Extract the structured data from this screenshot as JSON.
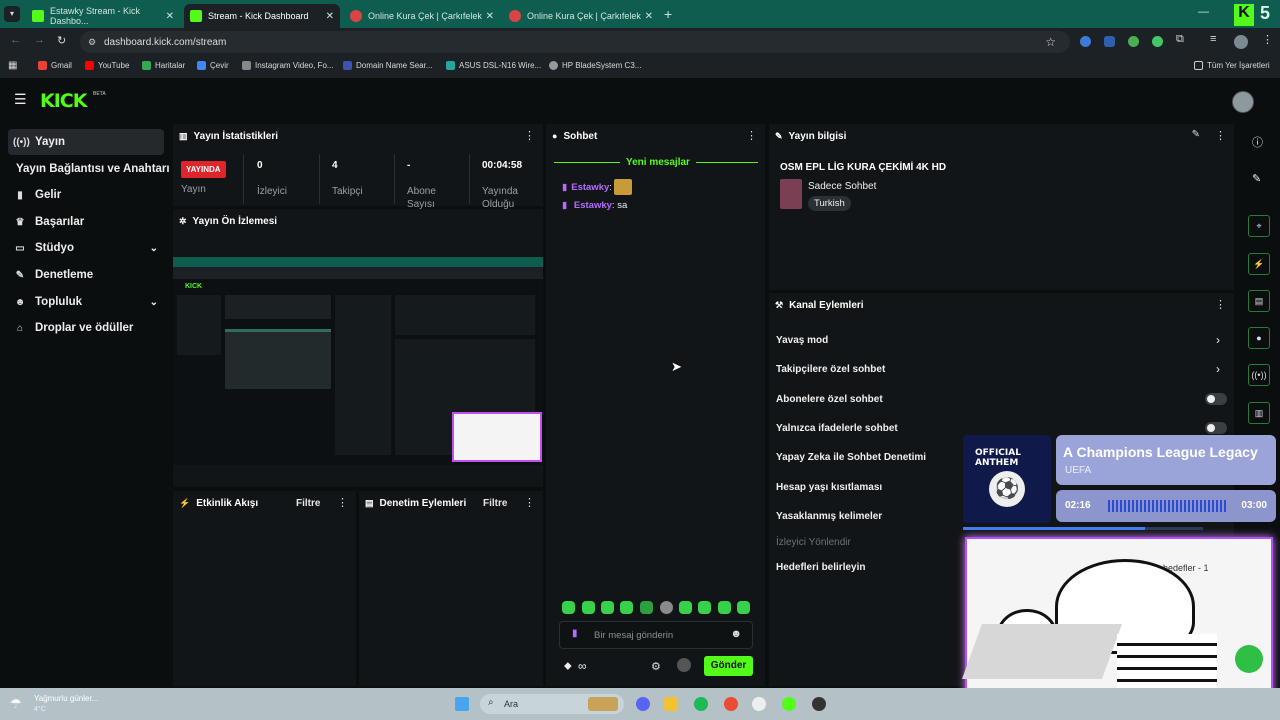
{
  "browser": {
    "tabs": [
      {
        "title": "Estawky Stream - Kick Dashbo..."
      },
      {
        "title": "Stream - Kick Dashboard"
      },
      {
        "title": "Online Kura Çek | Çarkıfelek"
      },
      {
        "title": "Online Kura Çek | Çarkıfelek"
      }
    ],
    "url": "dashboard.kick.com/stream",
    "bookmarks": [
      "Gmail",
      "YouTube",
      "Haritalar",
      "Çevir",
      "Instagram Video, Fo...",
      "Domain Name Sear...",
      "ASUS DSL-N16 Wire...",
      "HP BladeSystem C3..."
    ],
    "all_bookmarks": "Tüm Yer İşaretleri"
  },
  "kick": {
    "logo": "KICK",
    "beta": "BETA"
  },
  "sidebar": {
    "items": [
      {
        "label": "Yayın",
        "icon": "broadcast-icon"
      },
      {
        "label": "Yayın Bağlantısı ve Anahtarı",
        "icon": ""
      },
      {
        "label": "Gelir",
        "icon": "money-icon"
      },
      {
        "label": "Başarılar",
        "icon": "trophy-icon"
      },
      {
        "label": "Stüdyo",
        "icon": "layout-icon"
      },
      {
        "label": "Denetleme",
        "icon": "wrench-icon"
      },
      {
        "label": "Topluluk",
        "icon": "users-icon"
      },
      {
        "label": "Droplar ve ödüller",
        "icon": "gift-icon"
      }
    ]
  },
  "stats": {
    "title": "Yayın İstatistikleri",
    "live_badge": "YAYINDA",
    "live_label": "Yayın",
    "viewers": {
      "value": "0",
      "label": "İzleyici"
    },
    "followers": {
      "value": "4",
      "label": "Takipçi"
    },
    "subs": {
      "value": "-",
      "label": "Abone Sayısı"
    },
    "uptime": {
      "value": "00:04:58",
      "label": "Yayında Olduğu"
    }
  },
  "preview": {
    "title": "Yayın Ön İzlemesi"
  },
  "activity": {
    "title": "Etkinlik Akışı",
    "filter": "Filtre"
  },
  "modactions": {
    "title": "Denetim Eylemleri",
    "filter": "Filtre"
  },
  "chat": {
    "title": "Sohbet",
    "new_messages": "Yeni mesajlar",
    "messages": [
      {
        "user": "Estawky",
        "text": ""
      },
      {
        "user": "Estawky",
        "text": "sa"
      }
    ],
    "placeholder": "Bir mesaj gönderin",
    "send": "Gönder",
    "points": "∞"
  },
  "streaminfo": {
    "title": "Yayın bilgisi",
    "stream_title": "OSM EPL LİG KURA ÇEKİMİ 4K HD",
    "category": "Sadece Sohbet",
    "language": "Turkish"
  },
  "channel_actions": {
    "title": "Kanal Eylemleri",
    "items": [
      "Yavaş mod",
      "Takipçilere özel sohbet",
      "Abonelere özel sohbet",
      "Yalnızca ifadelerle sohbet",
      "Yapay Zeka ile Sohbet Denetimi",
      "Hesap yaşı kısıtlaması",
      "Yasaklanmış kelimeler",
      "İzleyici Yönlendir",
      "Hedefleri belirleyin"
    ],
    "goal_hint": "hedefler - 1"
  },
  "music_overlay": {
    "badge": "OFFICIAL ANTHEM",
    "track": "A Champions League Legacy",
    "artist": "UEFA",
    "elapsed": "02:16",
    "total": "03:00",
    "progress": 0.76
  },
  "taskbar": {
    "weather": "Yağmurlu günler...",
    "temp": "4°C",
    "search": "Ara"
  },
  "colors": {
    "kick_green": "#53fc18",
    "live_red": "#e0242c",
    "tab_teal": "#0f5d4f"
  }
}
